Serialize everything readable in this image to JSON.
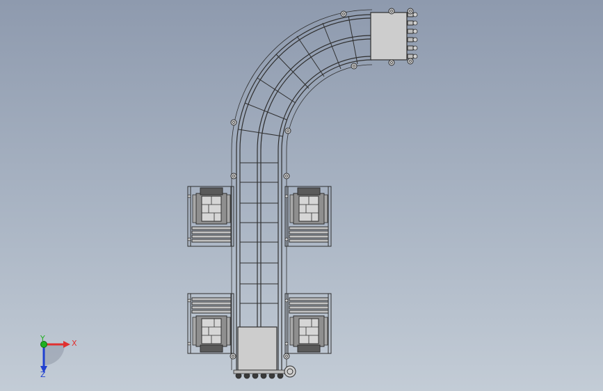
{
  "viewport": {
    "background_top": "#8e9aae",
    "background_bottom": "#c3ccd6",
    "line_color": "#2e2e2e",
    "plate_fill": "#c9c9c9",
    "box_fill": "#d4d4d4"
  },
  "triad": {
    "x_label": "X",
    "y_label": "Y",
    "z_label": "Z",
    "x_color": "#e03030",
    "y_color": "#20b020",
    "z_color": "#2040d0"
  }
}
